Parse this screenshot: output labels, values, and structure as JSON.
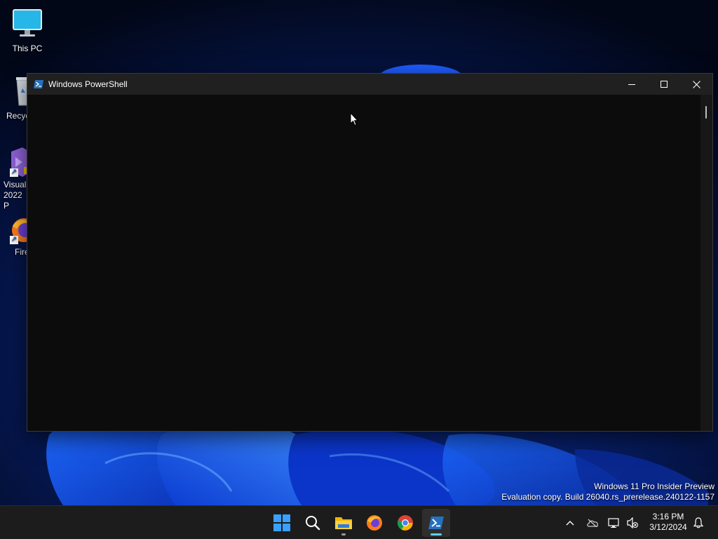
{
  "desktop": {
    "icons": [
      {
        "label": "This PC",
        "icon": "monitor-icon"
      },
      {
        "label": "Recycle Bin",
        "visible_label": "Recyc",
        "icon": "recycle-bin-icon"
      },
      {
        "label_line1": "Visual",
        "label_line2": "2022 P",
        "icon": "visual-studio-icon"
      },
      {
        "label": "Fire",
        "icon": "firefox-icon"
      }
    ]
  },
  "window": {
    "title": "Windows PowerShell",
    "icon": "powershell-icon",
    "controls": {
      "minimize": "minimize-icon",
      "maximize": "maximize-icon",
      "close": "close-icon"
    },
    "console_text": ""
  },
  "watermark": {
    "line1": "Windows 11 Pro Insider Preview",
    "line2": "Evaluation copy. Build 26040.rs_prerelease.240122-1157"
  },
  "taskbar": {
    "apps": [
      {
        "name": "Start",
        "icon": "windows-start-icon"
      },
      {
        "name": "Search",
        "icon": "search-icon"
      },
      {
        "name": "File Explorer",
        "icon": "folder-icon",
        "running": true
      },
      {
        "name": "Firefox",
        "icon": "firefox-icon"
      },
      {
        "name": "Google Chrome",
        "icon": "chrome-icon"
      },
      {
        "name": "Windows PowerShell",
        "icon": "powershell-icon",
        "active": true
      }
    ],
    "tray": [
      "chevron-up-icon",
      "onedrive-icon",
      "network-icon",
      "volume-muted-icon"
    ],
    "clock": {
      "time": "3:16 PM",
      "date": "3/12/2024"
    },
    "notification_icon": "bell-icon"
  },
  "colors": {
    "accent": "#60cdff",
    "titlebar": "#202020",
    "console_bg": "#0c0c0c",
    "taskbar": "#1c1c1c"
  }
}
